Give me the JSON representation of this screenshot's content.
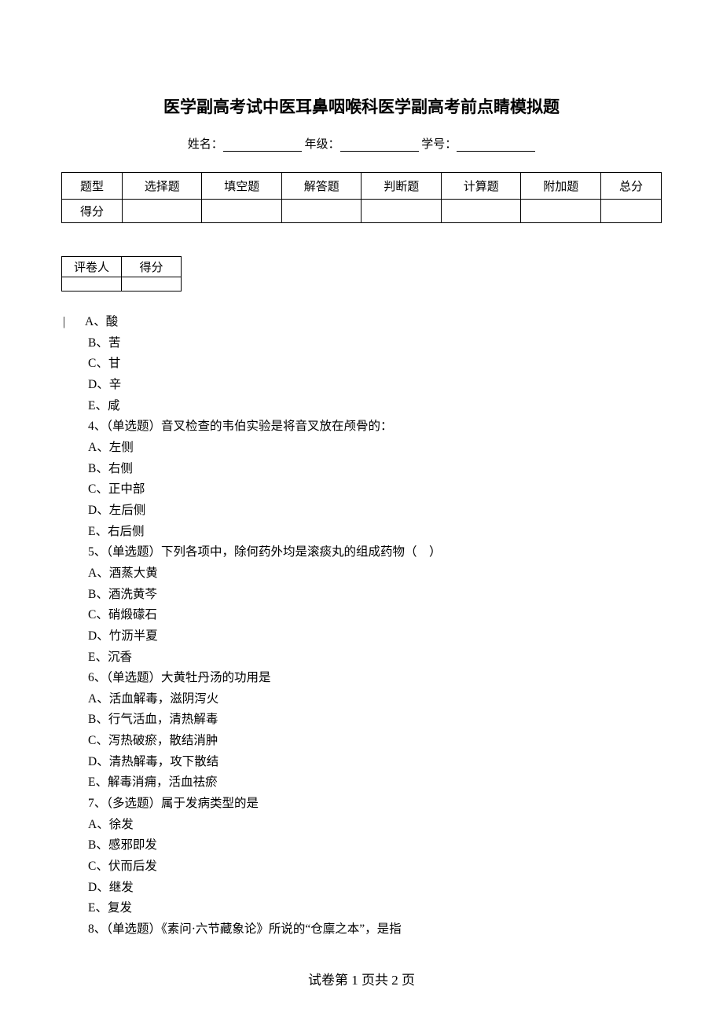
{
  "title": "医学副高考试中医耳鼻咽喉科医学副高考前点睛模拟题",
  "info": {
    "name_label": "姓名：",
    "grade_label": " 年级：",
    "id_label": " 学号：",
    "blank": ""
  },
  "score_table": {
    "headers": [
      "题型",
      "选择题",
      "填空题",
      "解答题",
      "判断题",
      "计算题",
      "附加题",
      "总分"
    ],
    "row_label": "得分"
  },
  "grader_table": {
    "headers": [
      "评卷人",
      "得分"
    ]
  },
  "body": [
    {
      "indent": "first",
      "prefix": "|",
      "text": "A、酸"
    },
    {
      "indent": "normal",
      "text": "B、苦"
    },
    {
      "indent": "normal",
      "text": "C、甘"
    },
    {
      "indent": "normal",
      "text": "D、辛"
    },
    {
      "indent": "normal",
      "text": "E、咸"
    },
    {
      "indent": "normal",
      "text": "4、（单选题）音叉检查的韦伯实验是将音叉放在颅骨的："
    },
    {
      "indent": "normal",
      "text": "A、左侧"
    },
    {
      "indent": "normal",
      "text": "B、右侧"
    },
    {
      "indent": "normal",
      "text": "C、正中部"
    },
    {
      "indent": "normal",
      "text": "D、左后侧"
    },
    {
      "indent": "normal",
      "text": "E、右后侧"
    },
    {
      "indent": "normal",
      "text": "5、（单选题）下列各项中，除何药外均是滚痰丸的组成药物（　）"
    },
    {
      "indent": "normal",
      "text": "A、酒蒸大黄"
    },
    {
      "indent": "normal",
      "text": "B、酒洗黄芩"
    },
    {
      "indent": "normal",
      "text": "C、硝煅礞石"
    },
    {
      "indent": "normal",
      "text": "D、竹沥半夏"
    },
    {
      "indent": "normal",
      "text": "E、沉香"
    },
    {
      "indent": "normal",
      "text": "6、（单选题）大黄牡丹汤的功用是"
    },
    {
      "indent": "normal",
      "text": "A、活血解毒，滋阴泻火"
    },
    {
      "indent": "normal",
      "text": "B、行气活血，清热解毒"
    },
    {
      "indent": "normal",
      "text": "C、泻热破瘀，散结消肿"
    },
    {
      "indent": "normal",
      "text": "D、清热解毒，攻下散结"
    },
    {
      "indent": "normal",
      "text": "E、解毒消痈，活血祛瘀"
    },
    {
      "indent": "normal",
      "text": "7、（多选题）属于发病类型的是"
    },
    {
      "indent": "normal",
      "text": "A、徐发"
    },
    {
      "indent": "normal",
      "text": "B、感邪即发"
    },
    {
      "indent": "normal",
      "text": "C、伏而后发"
    },
    {
      "indent": "normal",
      "text": "D、继发"
    },
    {
      "indent": "normal",
      "text": "E、复发"
    },
    {
      "indent": "normal",
      "text": "8、（单选题）《素问·六节藏象论》所说的“仓廪之本”，是指"
    }
  ],
  "footer": "试卷第 1 页共 2 页"
}
